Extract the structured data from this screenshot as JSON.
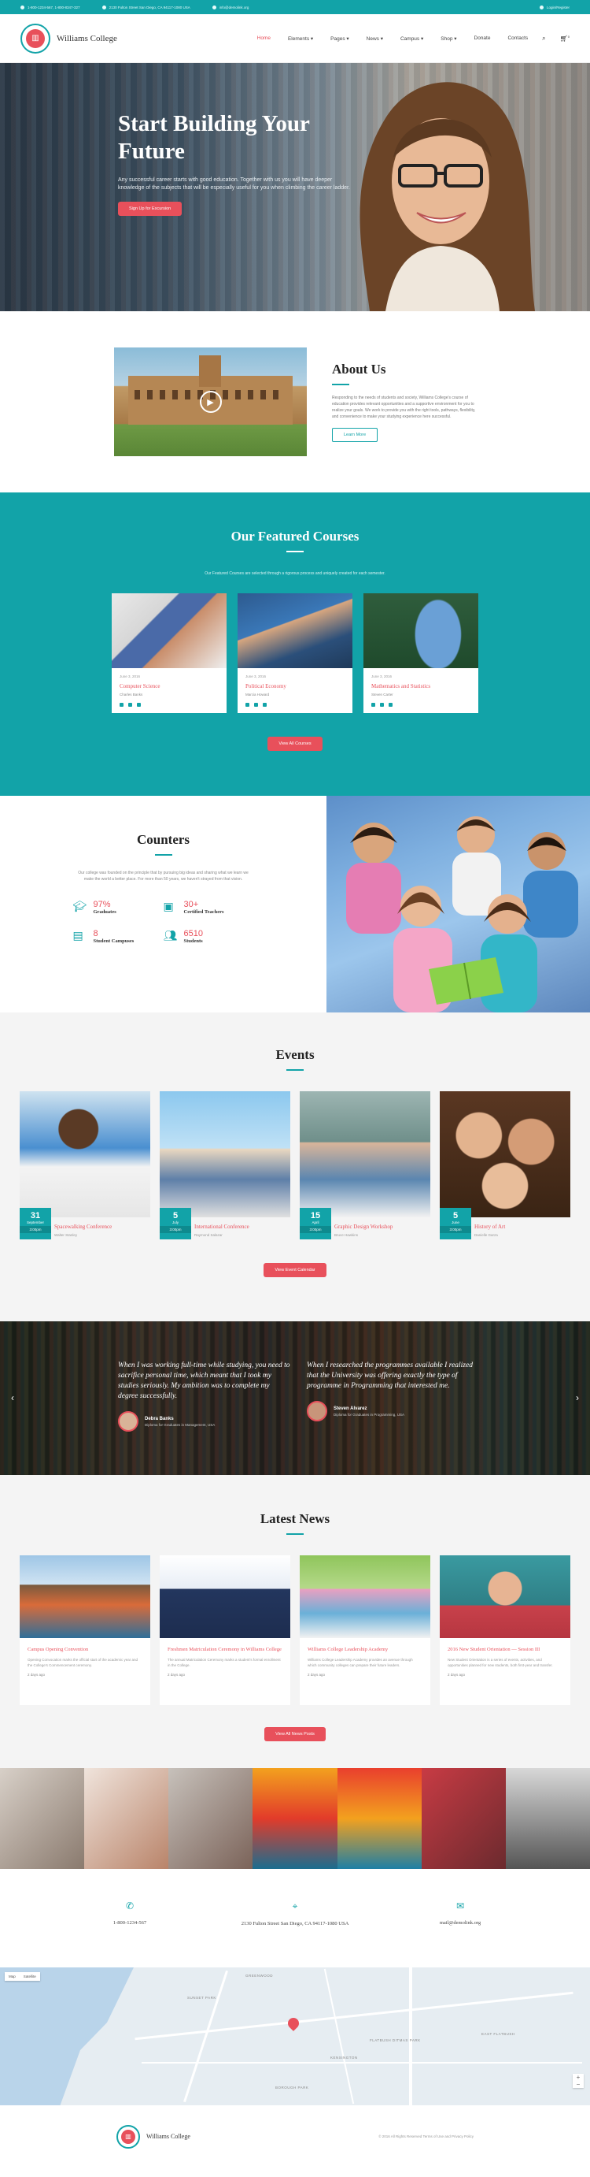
{
  "topbar": {
    "phone": "1-800-1234-567, 1-800-8347-327",
    "address": "2130 Fulton Street San Diego, CA 94117-1080 USA",
    "email": "info@demolink.org",
    "login": "Login/Register"
  },
  "header": {
    "site_name": "Williams College",
    "nav": [
      "Home",
      "Elements ▾",
      "Pages ▾",
      "News ▾",
      "Campus ▾",
      "Shop ▾",
      "Donate",
      "Contacts"
    ],
    "search_icon": "search-icon",
    "cart_icon": "cart-icon",
    "cart_count": "0"
  },
  "hero": {
    "title": "Start Building Your Future",
    "text": "Any successful career starts with good education. Together with us you will have deeper knowledge of the subjects that will be especially useful for you when climbing the career ladder.",
    "button": "Sign Up for Excursion"
  },
  "about": {
    "title": "About Us",
    "text": "Responding to the needs of students and society, Williams College's course of education provides relevant opportunities and a supportive environment for you to realize your goals. We work to provide you with the right tools, pathways, flexibility, and convenience to make your studying experience here successful.",
    "button": "Learn More"
  },
  "courses": {
    "title": "Our Featured Courses",
    "intro": "Our Featured Courses are selected through a rigorous process and uniquely created for each semester.",
    "items": [
      {
        "date": "June 3, 2016",
        "title": "Computer Science",
        "author": "Charles Banks"
      },
      {
        "date": "June 3, 2016",
        "title": "Political Economy",
        "author": "Marcia Howard"
      },
      {
        "date": "June 3, 2016",
        "title": "Mathematics and Statistics",
        "author": "Steven Carter"
      }
    ],
    "button": "View All Courses"
  },
  "counters": {
    "title": "Counters",
    "intro": "Our college was founded on the principle that by pursuing big ideas and sharing what we learn we make the world a better place. For more than 50 years, we haven't strayed from that vision.",
    "items": [
      {
        "icon": "graduation-cap-icon",
        "value": "97%",
        "label": "Graduates"
      },
      {
        "icon": "briefcase-icon",
        "value": "30+",
        "label": "Certified Teachers"
      },
      {
        "icon": "building-icon",
        "value": "8",
        "label": "Student Campuses"
      },
      {
        "icon": "students-icon",
        "value": "6510",
        "label": "Students"
      }
    ]
  },
  "events": {
    "title": "Events",
    "items": [
      {
        "day": "31",
        "month": "September",
        "time": "3:00pm",
        "title": "Spacewalking Conference",
        "location": "Walter Stanley"
      },
      {
        "day": "5",
        "month": "July",
        "time": "3:00pm",
        "title": "International Conference",
        "location": "Raymond Salazar"
      },
      {
        "day": "15",
        "month": "April",
        "time": "3:00pm",
        "title": "Graphic Design Workshop",
        "location": "Bruce Hawkins"
      },
      {
        "day": "5",
        "month": "June",
        "time": "3:00pm",
        "title": "History of Art",
        "location": "Danielle Garza"
      }
    ],
    "button": "View Event Calendar"
  },
  "testimonials": [
    {
      "quote": "When I was working full-time while studying, you need to sacrifice personal time, which meant that I took my studies seriously. My ambition was to complete my degree successfully.",
      "name": "Debra Banks",
      "role": "Diploma for Graduates in Management, USA"
    },
    {
      "quote": "When I researched the programmes available I realized that the University was offering exactly the type of programme in Programming that interested me.",
      "name": "Steven Alvarez",
      "role": "Diploma for Graduates in Programming, USA"
    }
  ],
  "news": {
    "title": "Latest News",
    "items": [
      {
        "title": "Campus Opening Convention",
        "excerpt": "Opening Convocation marks the official start of the academic year and the College's Commencement ceremony.",
        "date": "2 days ago"
      },
      {
        "title": "Freshmen Matriculation Ceremony in Williams College",
        "excerpt": "The annual Matriculation Ceremony marks a student's formal enrollment in the College.",
        "date": "2 days ago"
      },
      {
        "title": "Williams College Leadership Academy",
        "excerpt": "Williams College Leadership Academy provides an avenue through which community colleges can prepare their future leaders.",
        "date": "2 days ago"
      },
      {
        "title": "2016 New Student Orientation — Session III",
        "excerpt": "New Student Orientation is a series of events, activities, and opportunities planned for new students, both first-year and transfer.",
        "date": "2 days ago"
      }
    ],
    "button": "View All News Posts"
  },
  "contacts": [
    {
      "icon": "phone-icon",
      "text": "1-800-1234-567"
    },
    {
      "icon": "map-pin-icon",
      "text": "2130 Fulton Street San Diego, CA 94117-1080 USA"
    },
    {
      "icon": "mail-icon",
      "text": "mail@demolink.org"
    }
  ],
  "map": {
    "type_map": "Map",
    "type_satellite": "Satellite",
    "labels": [
      "GREENWOOD",
      "SUNSET PARK",
      "KENSINGTON",
      "FLATBUSH DITMAS PARK",
      "EAST FLATBUSH",
      "BOROUGH PARK"
    ]
  },
  "footer": {
    "site_name": "Williams College",
    "copy": "© 2016 All Rights Reserved Terms of Use and Privacy Policy"
  },
  "colors": {
    "accent": "#12a3a8",
    "brand_red": "#e8505b"
  }
}
